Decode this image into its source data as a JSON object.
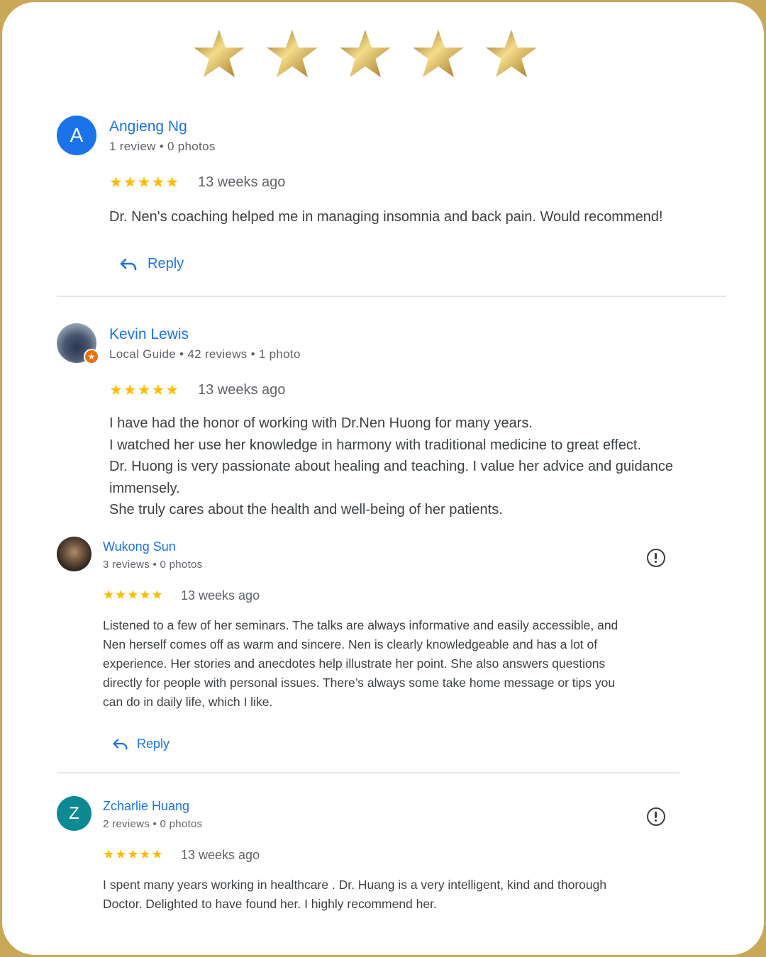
{
  "rating": 5,
  "colors": {
    "accent": "#1a73e8",
    "star": "#fbbc04",
    "gold": "#d4ac45"
  },
  "reviews": [
    {
      "initial": "A",
      "name": "Angieng Ng",
      "meta": "1 review • 0 photos",
      "stars": "★★★★★",
      "time": "13 weeks ago",
      "text": [
        "Dr. Nen's coaching helped me in managing insomnia and back pain. Would recommend!"
      ],
      "reply_label": "Reply"
    },
    {
      "name": "Kevin Lewis",
      "meta": "Local Guide • 42 reviews • 1 photo",
      "stars": "★★★★★",
      "time": "13 weeks ago",
      "text": [
        "I have had the honor of working with Dr.Nen Huong for many years.",
        "I watched her use her knowledge in harmony with traditional medicine to great effect.",
        "Dr. Huong is very passionate about healing and teaching. I value her advice and guidance",
        "immensely.",
        "She truly cares about the health and well-being of her patients."
      ]
    },
    {
      "name": "Wukong Sun",
      "meta": "3 reviews • 0 photos",
      "stars": "★★★★★",
      "time": "13 weeks ago",
      "text": [
        "Listened to a few of her seminars. The talks are always informative and easily accessible, and",
        "Nen herself comes off as warm and sincere. Nen is clearly knowledgeable and has a lot of",
        "experience. Her stories and anecdotes help illustrate her point. She also answers questions",
        "directly for people with personal issues. There’s always some take home message or tips you",
        "can do in daily life, which I like."
      ],
      "reply_label": "Reply"
    },
    {
      "initial": "Z",
      "name": "Zcharlie Huang",
      "meta": "2 reviews • 0 photos",
      "stars": "★★★★★",
      "time": "13 weeks ago",
      "text": [
        "I spent many years working in healthcare . Dr. Huang is a very intelligent, kind and thorough",
        "Doctor. Delighted to have found her. I highly recommend her."
      ]
    }
  ]
}
